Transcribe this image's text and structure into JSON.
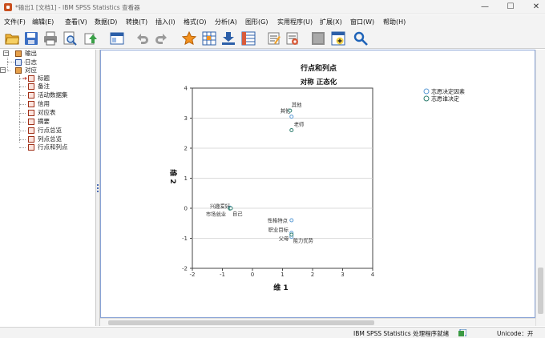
{
  "window": {
    "title": "*输出1 [文档1] - IBM SPSS Statistics 查看器",
    "minimize": "—",
    "maximize": "☐",
    "close": "✕"
  },
  "menu": [
    "文件(F)",
    "编辑(E)",
    "查看(V)",
    "数据(D)",
    "转换(T)",
    "插入(I)",
    "格式(O)",
    "分析(A)",
    "图形(G)",
    "实用程序(U)",
    "扩展(X)",
    "窗口(W)",
    "帮助(H)"
  ],
  "toolbar": {
    "icons": [
      "open-folder-icon",
      "save-icon",
      "print-icon",
      "print-preview-icon",
      "export-icon",
      "recall-dialog-icon",
      "undo-icon",
      "redo-icon",
      "go-to-data-icon",
      "go-to-case-icon",
      "insert-output-icon",
      "variables-icon",
      "show-all-icon",
      "hide-icon",
      "designate-window-icon",
      "select-output-icon",
      "search-icon"
    ]
  },
  "tree": {
    "root": "输出",
    "items": [
      {
        "label": "日志",
        "level": 2,
        "icon": "log"
      },
      {
        "label": "对应",
        "level": 2,
        "icon": "book"
      },
      {
        "label": "标题",
        "level": 3,
        "icon": "tbl"
      },
      {
        "label": "备注",
        "level": 3,
        "icon": "tbl"
      },
      {
        "label": "活动数据集",
        "level": 3,
        "icon": "tbl"
      },
      {
        "label": "信用",
        "level": 3,
        "icon": "tbl"
      },
      {
        "label": "对应表",
        "level": 3,
        "icon": "tbl"
      },
      {
        "label": "摘要",
        "level": 3,
        "icon": "tbl"
      },
      {
        "label": "行点总览",
        "level": 3,
        "icon": "tbl"
      },
      {
        "label": "列点总览",
        "level": 3,
        "icon": "tbl"
      },
      {
        "label": "行点和列点",
        "level": 3,
        "icon": "tbl"
      }
    ]
  },
  "chart_data": {
    "type": "scatter",
    "title": "行点和列点",
    "subtitle": "对称 正态化",
    "xlabel": "维 1",
    "ylabel": "维 2",
    "xlim": [
      -2,
      4
    ],
    "ylim": [
      -2,
      4
    ],
    "xticks": [
      -2,
      -1,
      0,
      1,
      2,
      3,
      4
    ],
    "yticks": [
      -2,
      -1,
      0,
      1,
      2,
      3,
      4
    ],
    "grid": "horizontal",
    "legend_position": "top-right",
    "series": [
      {
        "name": "志愿决定因素",
        "color": "#5b9bd5",
        "points": [
          {
            "label": "其他",
            "x": 1.3,
            "y": 3.05
          },
          {
            "label": "兴趣爱好",
            "x": -0.75,
            "y": 0.02
          },
          {
            "label": "性格特点",
            "x": 1.3,
            "y": -0.4
          },
          {
            "label": "职业目标",
            "x": 1.3,
            "y": -0.82
          },
          {
            "label": "能力优势",
            "x": 1.3,
            "y": -0.95
          }
        ]
      },
      {
        "name": "志愿谁决定",
        "color": "#2e7d6e",
        "points": [
          {
            "label": "其他",
            "x": 1.25,
            "y": 3.25
          },
          {
            "label": "老师",
            "x": 1.3,
            "y": 2.6
          },
          {
            "label": "市场就业",
            "x": -0.75,
            "y": -0.01
          },
          {
            "label": "自己",
            "x": -0.72,
            "y": 0.0
          },
          {
            "label": "父母",
            "x": 1.3,
            "y": -0.88
          }
        ]
      }
    ]
  },
  "status": {
    "processor": "IBM SPSS Statistics 处理程序就绪",
    "encoding": "Unicode：开"
  }
}
